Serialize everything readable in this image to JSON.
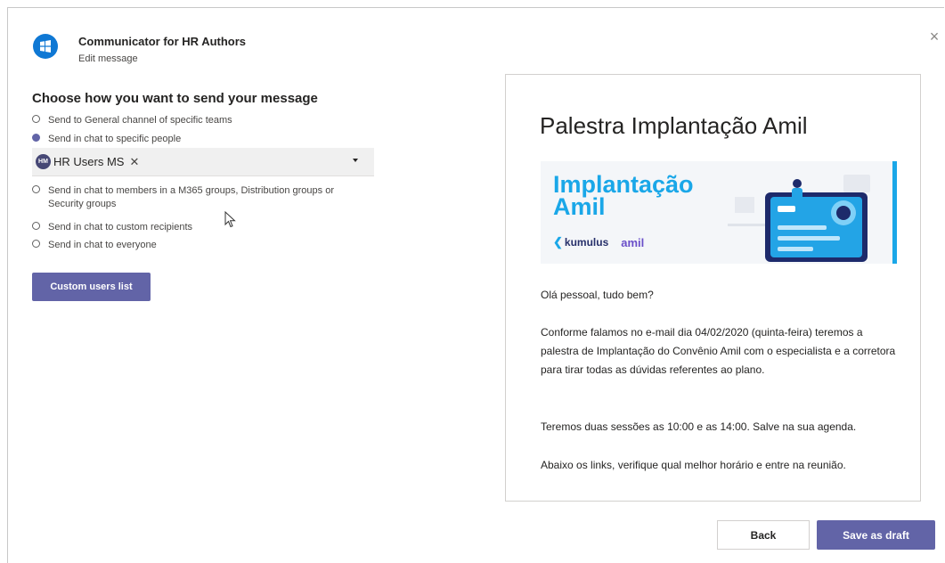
{
  "app": {
    "title": "Communicator for HR Authors",
    "subtitle": "Edit message"
  },
  "close_label": "×",
  "left": {
    "heading": "Choose how you want to send your message",
    "options": [
      {
        "label": "Send to General channel of specific teams",
        "selected": false
      },
      {
        "label": "Send in chat to specific people",
        "selected": true
      },
      {
        "label": "Send in chat to members in a M365 groups, Distribution groups or Security groups",
        "selected": false
      },
      {
        "label": "Send in chat to custom recipients",
        "selected": false
      },
      {
        "label": "Send in chat to everyone",
        "selected": false
      }
    ],
    "people_picker": {
      "avatar_initials": "HM",
      "selected": "HR Users MS",
      "remove_glyph": "✕"
    },
    "custom_users_button": "Custom users list"
  },
  "preview": {
    "title": "Palestra Implantação Amil",
    "banner": {
      "line1": "Implantação",
      "line2": "Amil",
      "brand1": "kumulus",
      "brand2": "amil",
      "accent": "#1aa7e8"
    },
    "paragraphs": [
      "Olá pessoal, tudo bem?",
      "Conforme falamos no e-mail dia 04/02/2020  (quinta-feira) teremos a palestra de Implantação do Convênio Amil com o especialista e a corretora para tirar todas as dúvidas referentes ao plano.",
      "Teremos duas sessões as 10:00 e as 14:00. Salve na sua agenda.",
      "Abaixo os links, verifique qual melhor horário e entre na reunião."
    ]
  },
  "footer": {
    "back": "Back",
    "save_draft": "Save as draft"
  },
  "colors": {
    "primary": "#6264a7",
    "brand_blue": "#0f78d4"
  }
}
